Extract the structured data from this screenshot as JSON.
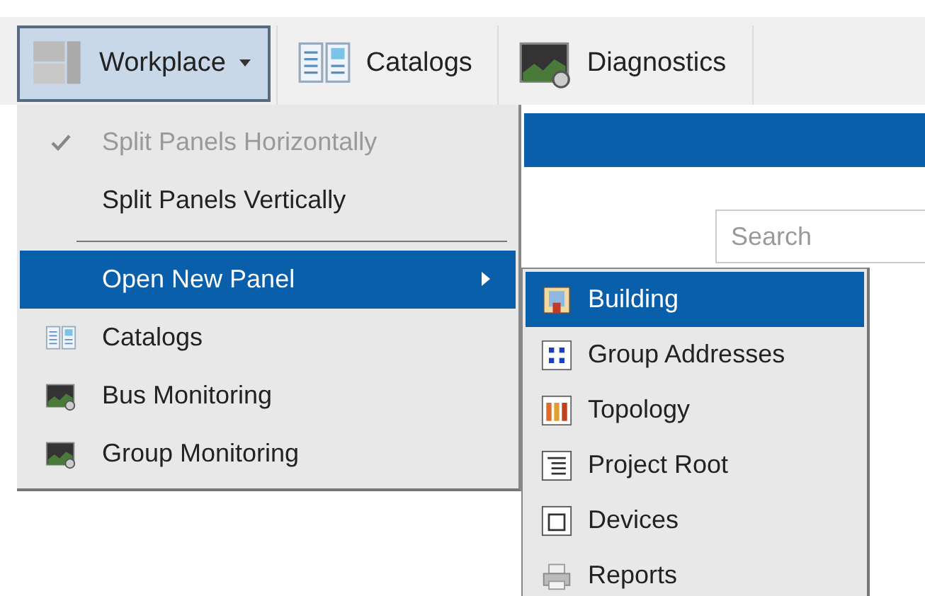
{
  "toolbar": [
    {
      "label": "Workplace",
      "selected": true,
      "dropdown": true
    },
    {
      "label": "Catalogs",
      "selected": false,
      "dropdown": false
    },
    {
      "label": "Diagnostics",
      "selected": false,
      "dropdown": false
    }
  ],
  "search": {
    "placeholder": "Search"
  },
  "menu": [
    {
      "kind": "item",
      "label": "Split Panels Horizontally",
      "checked": true,
      "disabled": true,
      "selected": false,
      "submenu": false
    },
    {
      "kind": "item",
      "label": "Split Panels Vertically",
      "checked": false,
      "disabled": false,
      "selected": false,
      "submenu": false
    },
    {
      "kind": "separator"
    },
    {
      "kind": "item",
      "label": "Open New Panel",
      "checked": false,
      "disabled": false,
      "selected": true,
      "submenu": true
    },
    {
      "kind": "item",
      "label": "Catalogs",
      "checked": false,
      "disabled": false,
      "selected": false,
      "submenu": false
    },
    {
      "kind": "item",
      "label": "Bus Monitoring",
      "checked": false,
      "disabled": false,
      "selected": false,
      "submenu": false
    },
    {
      "kind": "item",
      "label": "Group Monitoring",
      "checked": false,
      "disabled": false,
      "selected": false,
      "submenu": false
    }
  ],
  "submenu": [
    {
      "label": "Building",
      "selected": true
    },
    {
      "label": "Group Addresses",
      "selected": false
    },
    {
      "label": "Topology",
      "selected": false
    },
    {
      "label": "Project Root",
      "selected": false
    },
    {
      "label": "Devices",
      "selected": false
    },
    {
      "label": "Reports",
      "selected": false
    }
  ]
}
